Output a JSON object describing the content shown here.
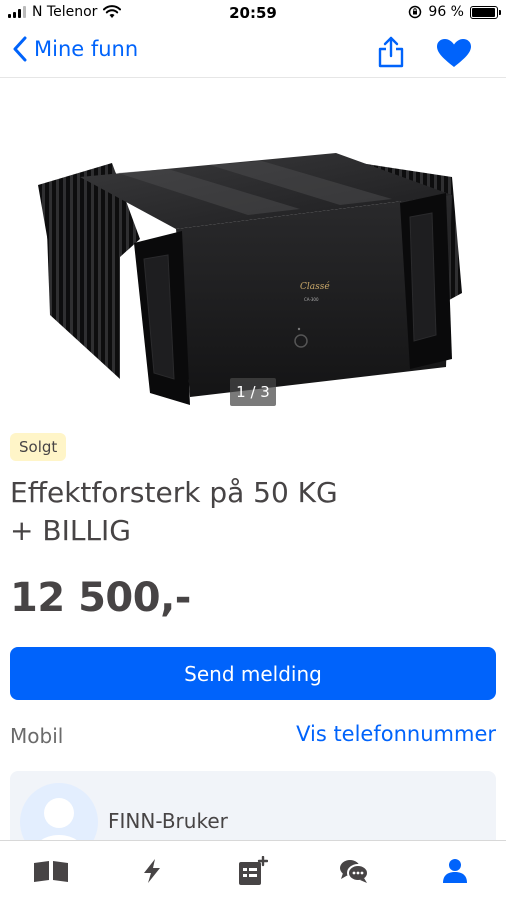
{
  "status_bar": {
    "carrier": "N Telenor",
    "time": "20:59",
    "battery": "96 %",
    "battery_level": 0.96
  },
  "nav": {
    "back_label": "Mine funn",
    "icons": [
      "chevron-left-icon",
      "share-icon",
      "heart-icon"
    ]
  },
  "gallery": {
    "counter": "1 / 3",
    "current": 1,
    "total": 3,
    "brand_text": "Classé",
    "model_text": "CA-300"
  },
  "ad": {
    "status_badge": "Solgt",
    "title_line1": "Effektforsterk på 50 KG",
    "title_line2": "+ BILLIG",
    "price": "12 500,-"
  },
  "actions": {
    "send_label": "Send melding",
    "phone_label": "Mobil",
    "phone_link": "Vis telefonnummer"
  },
  "seller": {
    "name": "FINN-Bruker"
  },
  "tab_bar": {
    "icons": [
      "browse-icon",
      "lightning-icon",
      "new-ad-icon",
      "messages-icon",
      "profile-icon"
    ],
    "active_index": 4
  },
  "colors": {
    "accent": "#0063fb",
    "badge_bg": "#fff5c8",
    "text": "#474445",
    "seller_card_bg": "#f1f4f9",
    "tab_icon": "#474445",
    "tab_active": "#0063fb"
  }
}
